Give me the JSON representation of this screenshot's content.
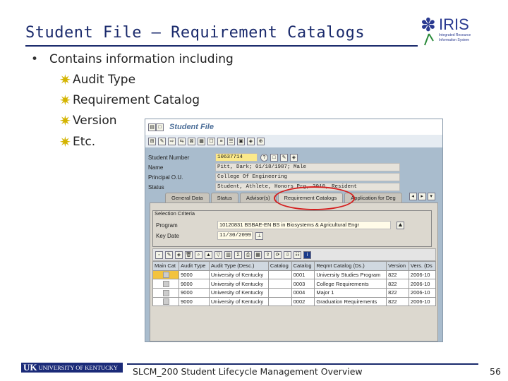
{
  "slide": {
    "title": "Student File – Requirement Catalogs",
    "bullet": "Contains information including",
    "subitems": [
      "Audit Type",
      "Requirement Catalog",
      "Version",
      "Etc."
    ],
    "footer": "SLCM_200 Student Lifecycle Management Overview",
    "page_number": "56"
  },
  "logo": {
    "name": "IRIS",
    "tagline": "Integrated Resource Information System"
  },
  "university_logo": {
    "initials": "UK",
    "name": "UNIVERSITY OF KENTUCKY"
  },
  "sap": {
    "window_title": "Student File",
    "fields": [
      {
        "label": "Student Number",
        "value": "10637714"
      },
      {
        "label": "Name",
        "value": "Pitt, Dark; 01/18/1987; Male"
      },
      {
        "label": "Principal O.U.",
        "value": "College Of Engineering"
      },
      {
        "label": "Status",
        "value": "Student, Athlete, Honors Prg, 2010, Resident"
      }
    ],
    "tabs": [
      "General Data",
      "Status",
      "Advisor(s)",
      "Requirement Catalogs",
      "Application for Deg"
    ],
    "active_tab": "Requirement Catalogs",
    "selection": {
      "title": "Selection Criteria",
      "program_label": "Program",
      "program_value": "10120831 BSBAE-EN BS in Biosystems & Agricultural Engr",
      "keydate_label": "Key Date",
      "keydate_value": "11/30/2099"
    },
    "table": {
      "columns": [
        "Main Cat",
        "Audit Type",
        "Audit Type (Desc.)",
        "Catalog",
        "Catalog",
        "Reqmt Catalog (Ds.)",
        "Version",
        "Vers. (Ds"
      ],
      "rows": [
        [
          "",
          "9000",
          "University of Kentucky",
          "",
          "0001",
          "University Studies Program",
          "822",
          "2006-10"
        ],
        [
          "",
          "9000",
          "University of Kentucky",
          "",
          "0003",
          "College Requirements",
          "822",
          "2006-10"
        ],
        [
          "",
          "9000",
          "University of Kentucky",
          "",
          "0004",
          "Major 1",
          "822",
          "2006-10"
        ],
        [
          "",
          "9000",
          "University of Kentucky",
          "",
          "0002",
          "Graduation Requirements",
          "822",
          "2006-10"
        ]
      ]
    }
  },
  "colors": {
    "title": "#1a2a6c",
    "highlight_circle": "#d42020",
    "sap_bg": "#a9bccd"
  }
}
